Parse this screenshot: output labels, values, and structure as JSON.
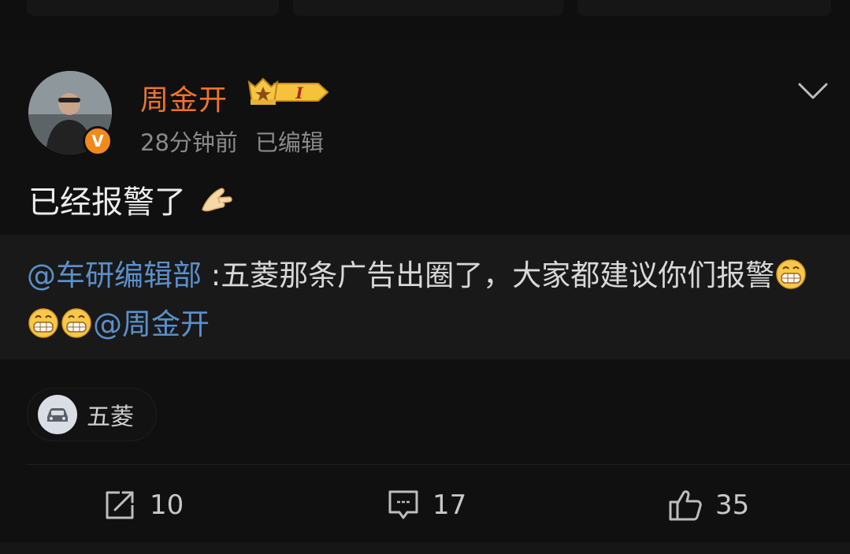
{
  "post": {
    "author": "周金开",
    "level_badge": "I",
    "time": "28分钟前",
    "edited": "已编辑",
    "text": "已经报警了",
    "quoted": {
      "mention": "@车研编辑部",
      "text": " :五菱那条广告出圈了，大家都建议你们报警",
      "trailing_mention": "@周金开"
    },
    "topic_tag": "五菱"
  },
  "actions": {
    "repost_count": "10",
    "comment_count": "17",
    "like_count": "35"
  },
  "icons": [
    "verified-badge-icon",
    "crown-level-icon",
    "chevron-down-icon",
    "pinching-hand-icon",
    "grin-emoji-icon",
    "car-icon",
    "repost-icon",
    "comment-icon",
    "like-icon"
  ],
  "colors": {
    "username": "#f0742a",
    "mention": "#5b8fc9",
    "verified": "#f08a1c",
    "background": "#101010",
    "quote_background": "#191919"
  }
}
